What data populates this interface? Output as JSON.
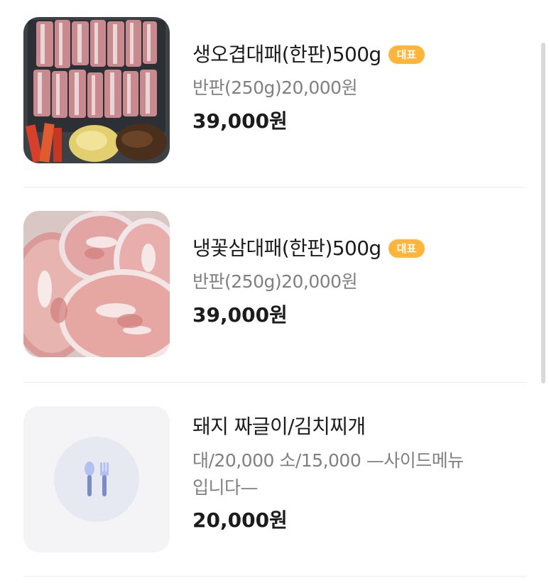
{
  "menu_items": [
    {
      "name": "생오겹대패(한판)500g",
      "badge": "대표",
      "description": "반판(250g)20,000원",
      "price": "39,000원",
      "image_icon": "pork-belly-photo"
    },
    {
      "name": "냉꽃삼대패(한판)500g",
      "badge": "대표",
      "description": "반판(250g)20,000원",
      "price": "39,000원",
      "image_icon": "frozen-pork-photo"
    },
    {
      "name": "돼지 짜글이/김치찌개",
      "description_line1": "대/20,000 소/15,000 —사이드메뉴",
      "description_line2": "입니다—",
      "price": "20,000원",
      "image_icon": "utensils-icon"
    }
  ],
  "colors": {
    "badge": "#ffb43a",
    "description": "#808080",
    "divider": "#ececec",
    "placeholder_bg": "#f4f4f6",
    "utensils": "#7b8bc4"
  }
}
